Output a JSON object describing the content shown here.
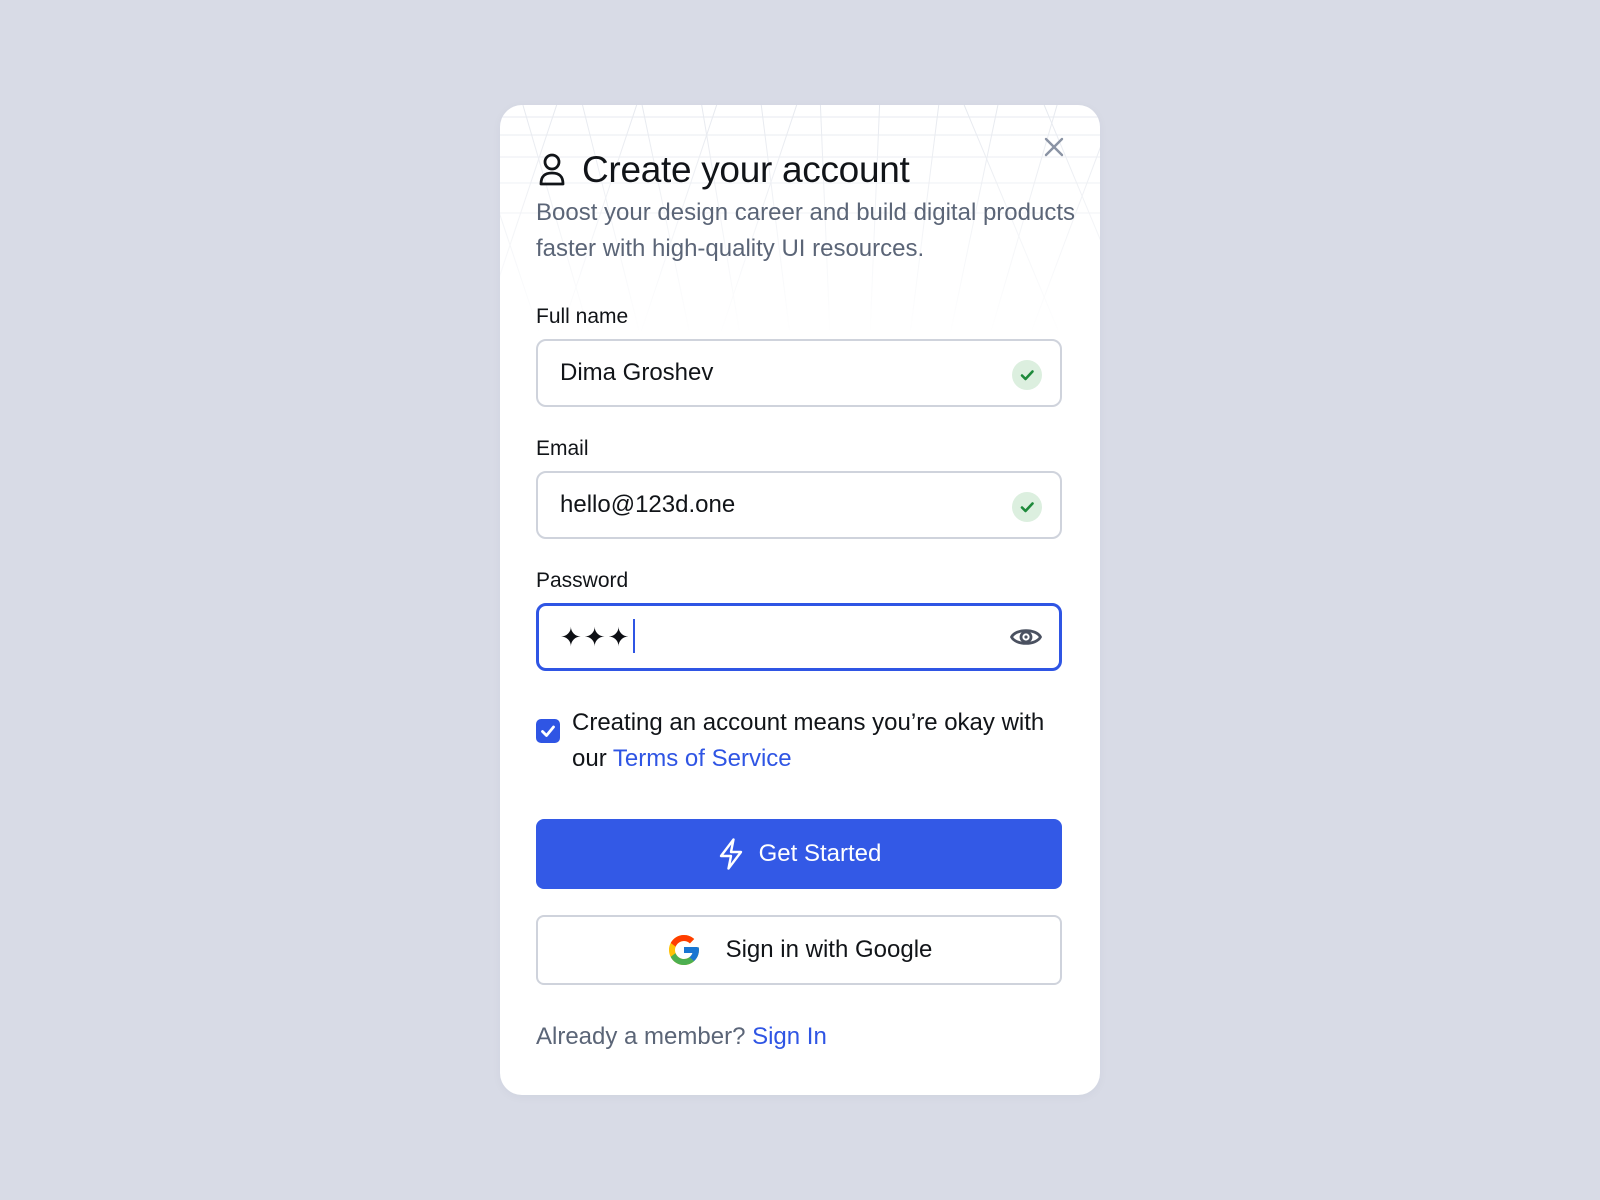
{
  "dialog": {
    "title": "Create your account",
    "subtitle": "Boost your design career and build digital products faster with high-quality UI resources."
  },
  "fields": {
    "full_name": {
      "label": "Full name",
      "value": "Dima Groshev",
      "status": "valid"
    },
    "email": {
      "label": "Email",
      "value": "hello@123d.one",
      "status": "valid"
    },
    "password": {
      "label": "Password",
      "masked_value": "✦✦✦",
      "state": "focused"
    }
  },
  "terms": {
    "checked": true,
    "text": "Creating an account means you’re okay with our ",
    "link_label": "Terms of Service"
  },
  "actions": {
    "primary_label": "Get Started",
    "google_label": "Sign in with Google"
  },
  "footer": {
    "text": "Already a member? ",
    "link_label": "Sign In"
  },
  "icons": {
    "title": "user-icon",
    "close": "close-icon",
    "valid": "check-icon",
    "password_toggle": "eye-icon",
    "checkbox": "checkmark-icon",
    "primary": "lightning-icon",
    "google": "google-logo-icon"
  },
  "colors": {
    "background": "#d8dbe6",
    "accent": "#3359e6",
    "link": "#2f55e4",
    "muted_text": "#5b6577",
    "success_bg": "#dcefdf",
    "success_check": "#1e8a3b"
  }
}
